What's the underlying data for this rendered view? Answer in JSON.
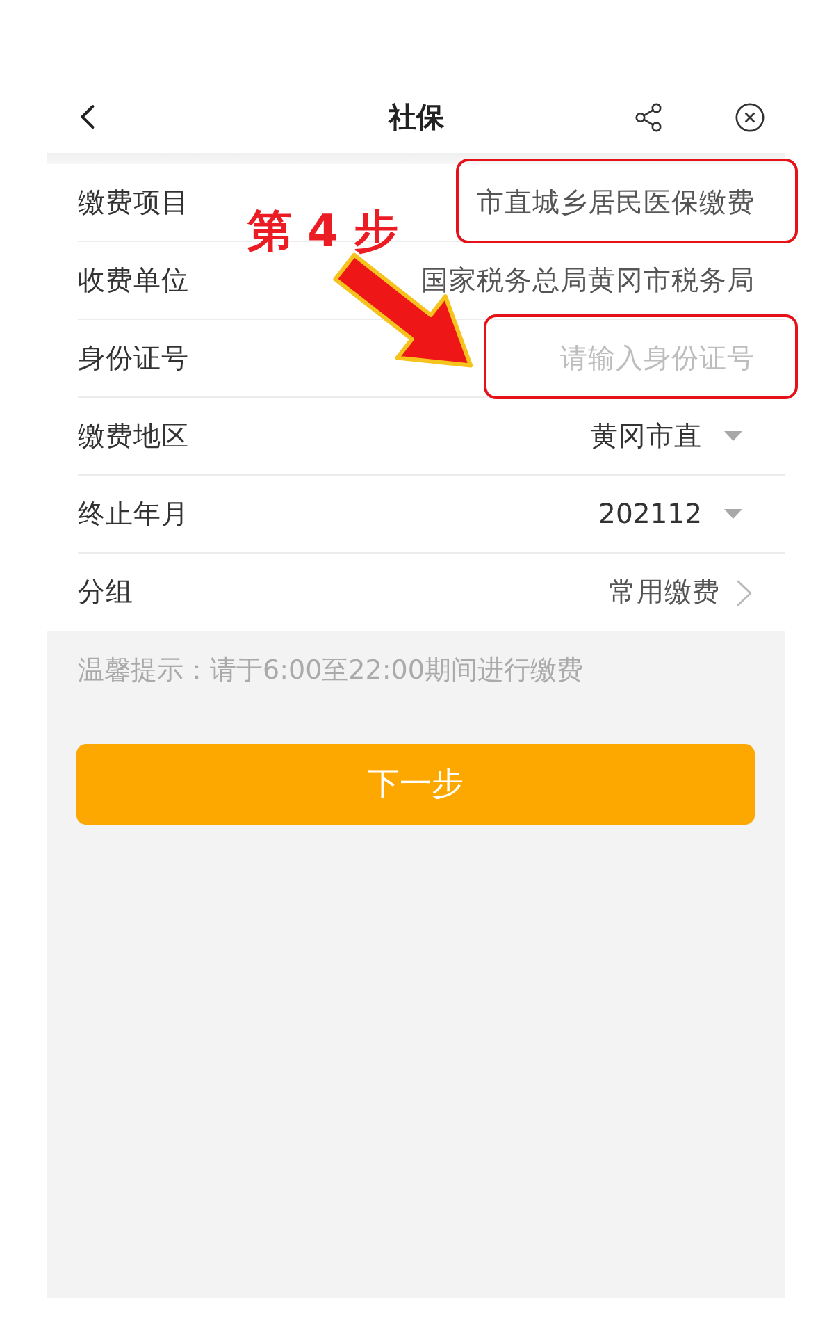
{
  "header": {
    "title": "社保"
  },
  "form": {
    "rows": [
      {
        "kind": "text",
        "label": "缴费项目",
        "value": "市直城乡居民医保缴费",
        "highlighted": true
      },
      {
        "kind": "text",
        "label": "收费单位",
        "value": "国家税务总局黄冈市税务局",
        "highlighted": false
      },
      {
        "kind": "input",
        "label": "身份证号",
        "placeholder": "请输入身份证号",
        "highlighted": true
      },
      {
        "kind": "dropdown",
        "label": "缴费地区",
        "value": "黄冈市直",
        "highlighted": false
      },
      {
        "kind": "dropdown",
        "label": "终止年月",
        "value": "202112",
        "highlighted": false
      },
      {
        "kind": "link",
        "label": "分组",
        "value": "常用缴费",
        "highlighted": false
      }
    ]
  },
  "hint": "温馨提示：请于6:00至22:00期间进行缴费",
  "next_button": {
    "label": "下一步"
  },
  "annotation": {
    "step_label": "第 4 步"
  }
}
